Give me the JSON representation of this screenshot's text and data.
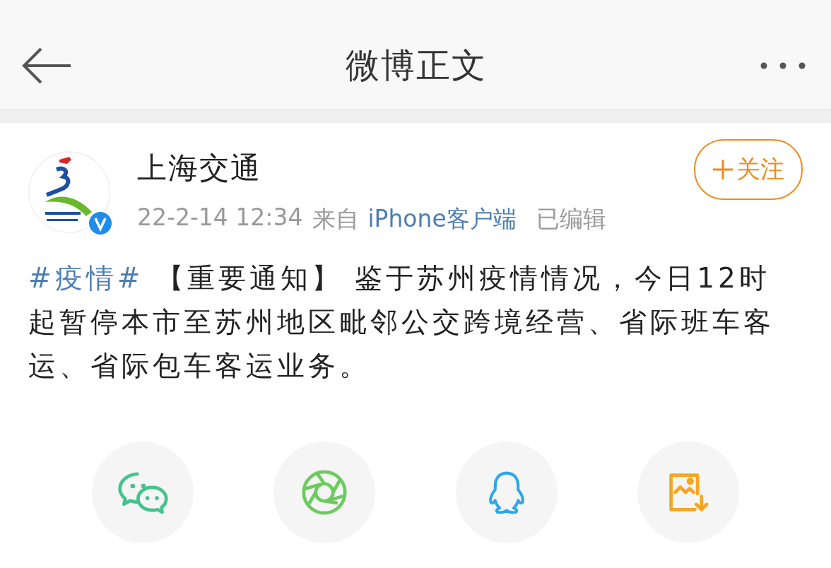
{
  "nav_bar": {
    "title": "微博正文"
  },
  "post": {
    "author": "上海交通",
    "verified": true,
    "time": "22-2-14 12:34",
    "source_prefix": "来自",
    "source": "iPhone客户端",
    "edited": "已编辑",
    "follow_button": "关注",
    "body": {
      "hashtag": "#疫情#",
      "text": " 【重要通知】 鉴于苏州疫情情况，今日12时起暂停本市至苏州地区毗邻公交跨境经营、省际班车客运、省际包车客运业务。"
    }
  },
  "share_buttons": [
    {
      "kind": "wechat"
    },
    {
      "kind": "moments"
    },
    {
      "kind": "qq"
    },
    {
      "kind": "save"
    }
  ]
}
